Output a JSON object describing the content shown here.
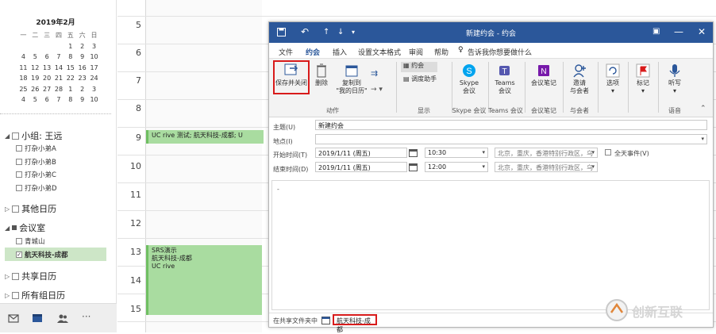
{
  "mini_calendar": {
    "title": "2019年2月",
    "weekdays": [
      "一",
      "二",
      "三",
      "四",
      "五",
      "六",
      "日"
    ],
    "weeks": [
      [
        "",
        "",
        "",
        "",
        "1",
        "2",
        "3"
      ],
      [
        "4",
        "5",
        "6",
        "7",
        "8",
        "9",
        "10"
      ],
      [
        "11",
        "12",
        "13",
        "14",
        "15",
        "16",
        "17"
      ],
      [
        "18",
        "19",
        "20",
        "21",
        "22",
        "23",
        "24"
      ],
      [
        "25",
        "26",
        "27",
        "28",
        "1",
        "2",
        "3"
      ],
      [
        "4",
        "5",
        "6",
        "7",
        "8",
        "9",
        "10"
      ]
    ]
  },
  "folders": {
    "group_label": "小组: 王远",
    "group_items": [
      "打杂小弟A",
      "打杂小弟B",
      "打杂小弟C",
      "打杂小弟D"
    ],
    "other_calendars": "其他日历",
    "meeting_room_label": "会议室",
    "meeting_room_items": [
      "青城山",
      "航天科技-成都"
    ],
    "shared_calendars": "共享日历",
    "all_group_calendars": "所有组日历"
  },
  "calendar_grid": {
    "hours": [
      "5",
      "6",
      "7",
      "8",
      "9",
      "10",
      "11",
      "12",
      "13",
      "14",
      "15"
    ],
    "events": [
      {
        "text": "UC                rive 测试; 航天科技-成都; U"
      },
      {
        "line1": "SRS演示",
        "line2": "航天科技-成都",
        "line3": "UC                rive"
      }
    ]
  },
  "window": {
    "title": "新建约会 - 约会",
    "menu": [
      "文件",
      "约会",
      "插入",
      "设置文本格式",
      "审阅",
      "帮助"
    ],
    "tell_me": "告诉我你想要做什么",
    "ribbon": {
      "save_close": "保存并关闭",
      "delete": "删除",
      "copy_to_line1": "复制到",
      "copy_to_line2": "\"我的日历\"",
      "appointment": "约会",
      "scheduling_assistant": "调度助手",
      "skype_line1": "Skype",
      "skype_line2": "会议",
      "teams_line1": "Teams",
      "teams_line2": "会议",
      "meeting_notes": "会议笔记",
      "invite_line1": "邀请",
      "invite_line2": "与会者",
      "options": "选项",
      "tags": "标记",
      "dictate": "听写",
      "group_actions": "动作",
      "group_show": "显示",
      "group_skype": "Skype 会议",
      "group_teams": "Teams 会议",
      "group_notes": "会议笔记",
      "group_attendees": "与会者",
      "group_voice": "语音"
    },
    "form": {
      "subject_label": "主题(U)",
      "subject_value": "新建约会",
      "location_label": "地点(I)",
      "location_value": "",
      "start_label": "开始时间(T)",
      "start_date": "2019/1/11 (周五)",
      "start_time": "10:30",
      "start_tz": "北京，重庆，香港特别行政区，乌",
      "all_day_label": "全天事件(V)",
      "end_label": "结束时间(D)",
      "end_date": "2019/1/11 (周五)",
      "end_time": "12:00",
      "end_tz": "北京，重庆，香港特别行政区，乌",
      "body_text": "-"
    },
    "footer": {
      "shared_folder_label": "在共享文件夹中",
      "calendar_name": "航天科技-成都"
    }
  },
  "watermark": {
    "text": "创新互联"
  },
  "colors": {
    "title_blue": "#2b579a",
    "event_green": "#a9dca0",
    "highlight_red": "#d81b1b"
  }
}
